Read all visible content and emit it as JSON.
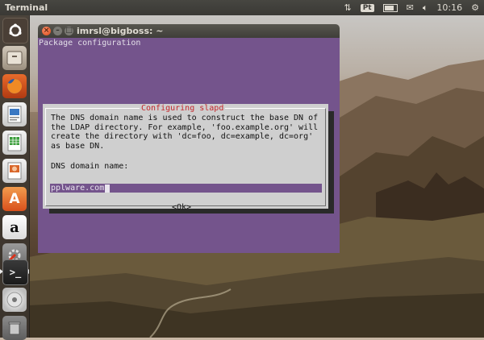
{
  "top_panel": {
    "app_name": "Terminal",
    "keyboard_layout": "Pt",
    "clock": "10:16",
    "icons": [
      "network-updown-icon",
      "keyboard-layout-icon",
      "battery-icon",
      "mail-envelope-icon",
      "volume-icon",
      "clock",
      "power-gear-icon"
    ]
  },
  "launcher": {
    "items": [
      {
        "name": "dash-home",
        "icon": "ubuntu-logo-icon"
      },
      {
        "name": "files",
        "icon": "file-cabinet-icon"
      },
      {
        "name": "firefox",
        "icon": "firefox-icon"
      },
      {
        "name": "writer",
        "icon": "libreoffice-writer-icon"
      },
      {
        "name": "calc",
        "icon": "libreoffice-calc-icon"
      },
      {
        "name": "impress",
        "icon": "libreoffice-impress-icon"
      },
      {
        "name": "software-center",
        "icon": "software-center-bag-icon"
      },
      {
        "name": "amazon",
        "icon": "amazon-icon"
      },
      {
        "name": "system-settings",
        "icon": "settings-wrench-icon"
      },
      {
        "name": "terminal",
        "icon": "terminal-icon"
      },
      {
        "name": "dvd",
        "icon": "disc-icon"
      },
      {
        "name": "trash",
        "icon": "trash-icon"
      }
    ]
  },
  "window": {
    "title": "imrsl@bigboss: ~"
  },
  "terminal": {
    "header": "Package configuration"
  },
  "dialog": {
    "title": "Configuring slapd",
    "line1": "The DNS domain name is used to construct the base DN of",
    "line2": "the LDAP directory. For example, 'foo.example.org' will",
    "line3": "create the directory with 'dc=foo, dc=example, dc=org'",
    "line4": "as base DN.",
    "field_label": "DNS domain name:",
    "field_value": "pplware.com",
    "ok_label": "<Ok>"
  },
  "colors": {
    "terminal_bg": "#74548c",
    "dialog_bg": "#cfcfcf",
    "dialog_title": "#c4282c",
    "close_button": "#dd4814"
  }
}
